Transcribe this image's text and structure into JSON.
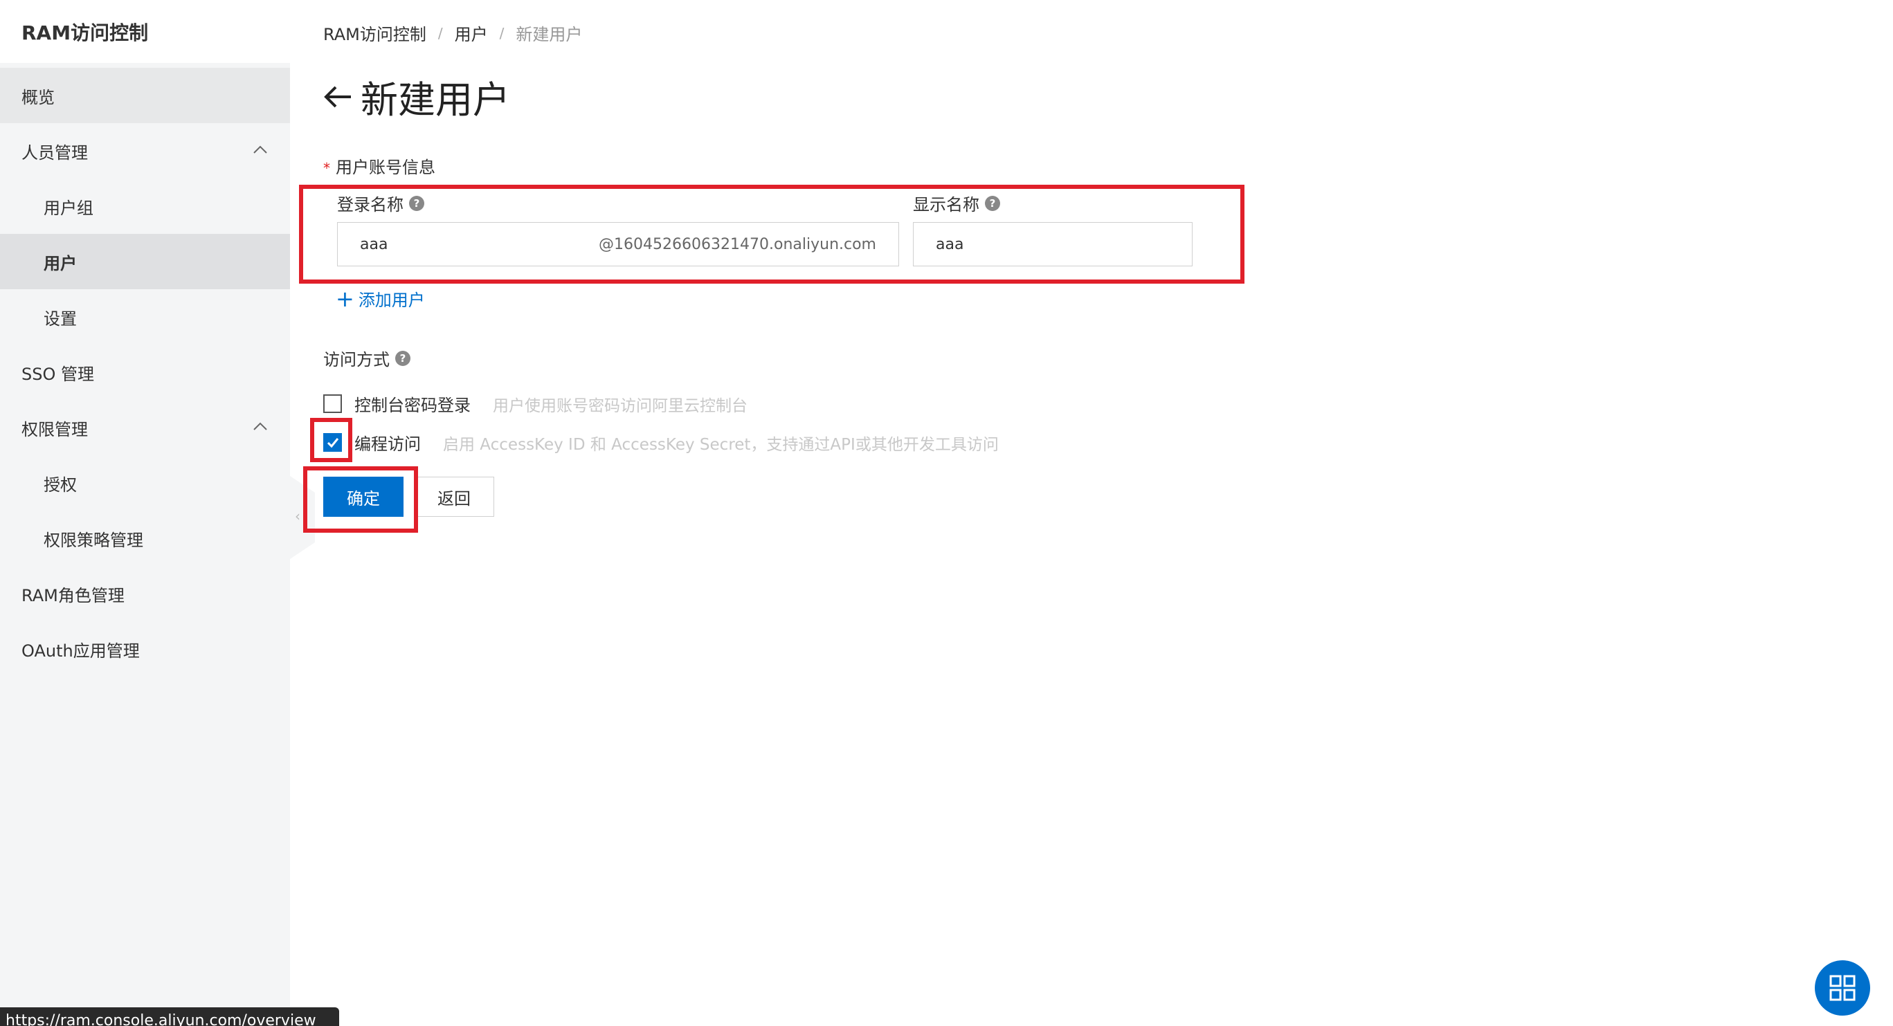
{
  "sidebar": {
    "title": "RAM访问控制",
    "items": [
      {
        "label": "概览"
      },
      {
        "label": "人员管理"
      },
      {
        "label": "用户组"
      },
      {
        "label": "用户"
      },
      {
        "label": "设置"
      },
      {
        "label": "SSO 管理"
      },
      {
        "label": "权限管理"
      },
      {
        "label": "授权"
      },
      {
        "label": "权限策略管理"
      },
      {
        "label": "RAM角色管理"
      },
      {
        "label": "OAuth应用管理"
      }
    ]
  },
  "breadcrumb": {
    "items": [
      "RAM访问控制",
      "用户",
      "新建用户"
    ],
    "separator": "/"
  },
  "page": {
    "title": "新建用户"
  },
  "form": {
    "section_label": "用户账号信息",
    "required_mark": "*",
    "login_name_label": "登录名称",
    "display_name_label": "显示名称",
    "login_name_value": "aaa",
    "login_name_suffix": "@1604526606321470.onaliyun.com",
    "display_name_value": "aaa",
    "add_user_label": "添加用户",
    "access_label": "访问方式",
    "help_glyph": "?",
    "options": [
      {
        "label": "控制台密码登录",
        "desc": "用户使用账号密码访问阿里云控制台",
        "checked": false
      },
      {
        "label": "编程访问",
        "desc": "启用 AccessKey ID 和 AccessKey Secret，支持通过API或其他开发工具访问",
        "checked": true
      }
    ],
    "confirm_label": "确定",
    "back_label": "返回"
  },
  "status_bar": {
    "url": "https://ram.console.aliyun.com/overview"
  },
  "colors": {
    "accent": "#0070cc",
    "highlight": "#e0202a",
    "sidebar_bg": "#f4f5f6"
  }
}
